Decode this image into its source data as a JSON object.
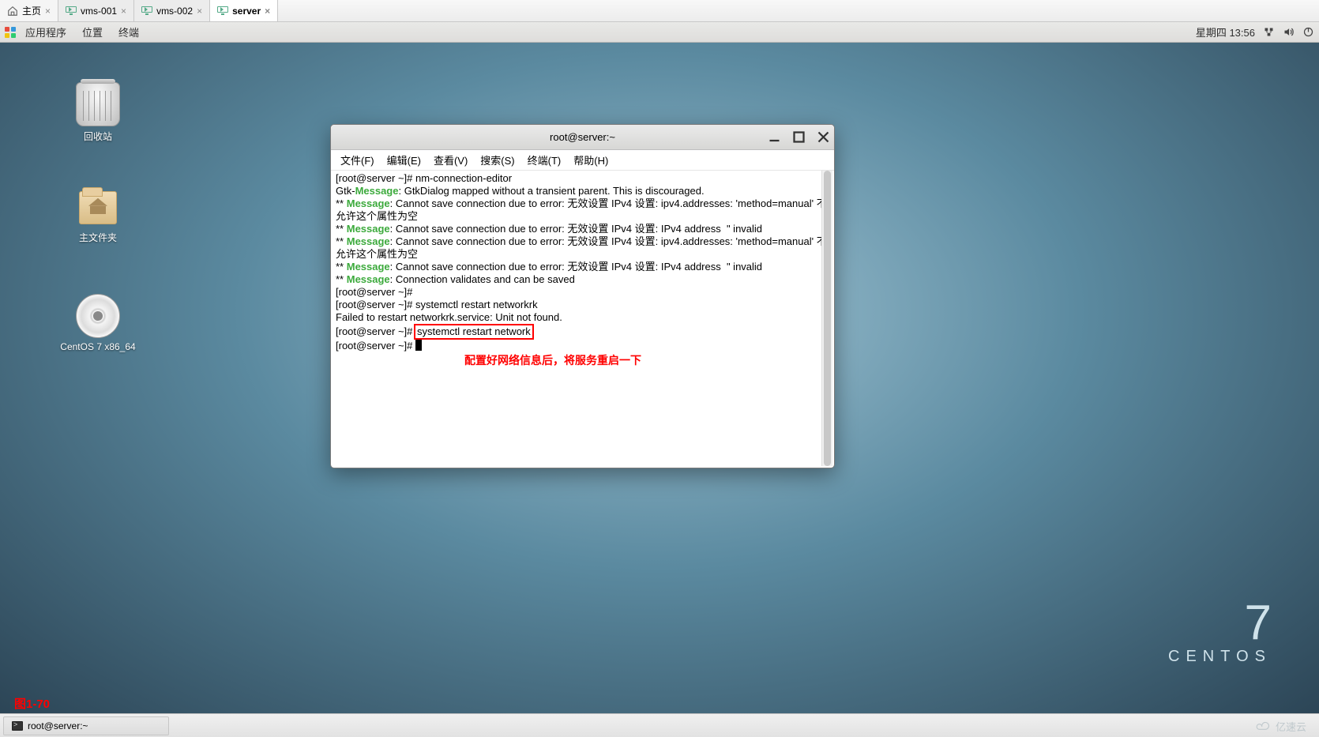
{
  "vmtabs": {
    "home": "主页",
    "t1": "vms-001",
    "t2": "vms-002",
    "t3": "server"
  },
  "panel": {
    "apps": "应用程序",
    "places": "位置",
    "terminal": "终端",
    "datetime": "星期四 13:56"
  },
  "desktop": {
    "trash": "回收站",
    "home": "主文件夹",
    "disc": "CentOS 7 x86_64"
  },
  "termwin": {
    "title": "root@server:~",
    "menu": {
      "file": "文件(F)",
      "edit": "编辑(E)",
      "view": "查看(V)",
      "search": "搜索(S)",
      "terminal": "终端(T)",
      "help": "帮助(H)"
    },
    "lines": {
      "p1a": "[root@server ~]# nm-connection-editor",
      "p2a": "Gtk-",
      "p2b": ": GtkDialog mapped without a transient parent. This is discouraged.",
      "p3a": "** ",
      "p3b": ": Cannot save connection due to error: 无效设置 IPv4 设置: ipv4.addresses: 'method=manual' 不允许这个属性为空",
      "p4b": ": Cannot save connection due to error: 无效设置 IPv4 设置: IPv4 address  \" invalid",
      "p5b": ": Cannot save connection due to error: 无效设置 IPv4 设置: ipv4.addresses: 'method=manual' 不允许这个属性为空",
      "p6b": ": Cannot save connection due to error: 无效设置 IPv4 设置: IPv4 address  \" invalid",
      "p7b": ": Connection validates and can be saved",
      "p8": "[root@server ~]# ",
      "p9": "[root@server ~]# systemctl restart networkrk",
      "p10": "Failed to restart networkrk.service: Unit not found.",
      "p11a": "[root@server ~]# ",
      "p11b": "systemctl restart network",
      "p12": "[root@server ~]# "
    },
    "message_label": "Message",
    "annotation": "配置好网络信息后，将服务重启一下"
  },
  "centos": {
    "seven": "7",
    "word": "CENTOS"
  },
  "figlabel": "图1-70",
  "taskbar": {
    "item1": "root@server:~"
  },
  "watermark": "亿速云"
}
